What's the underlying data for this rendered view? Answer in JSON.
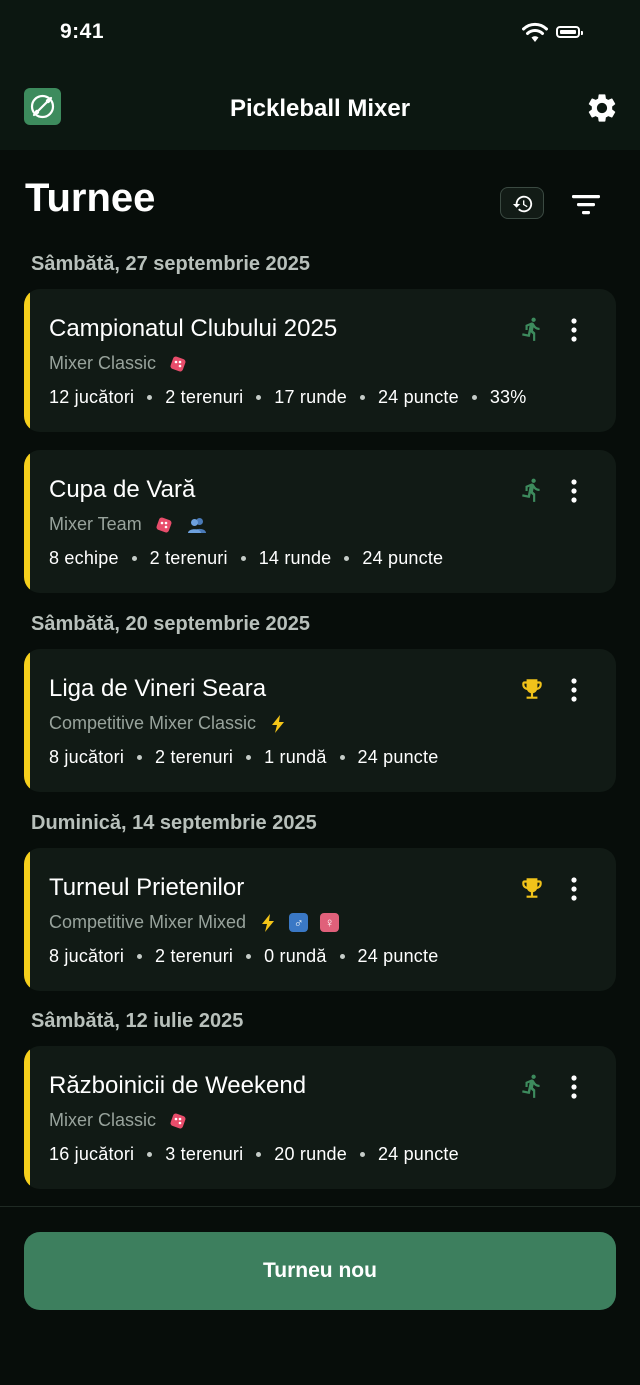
{
  "status_bar": {
    "time": "9:41"
  },
  "app_bar": {
    "title": "Pickleball Mixer"
  },
  "page": {
    "title": "Turnee"
  },
  "date_headers": [
    "Sâmbătă, 27 septembrie 2025",
    "Sâmbătă, 20 septembrie 2025",
    "Duminică, 14 septembrie 2025",
    "Sâmbătă, 12 iulie 2025"
  ],
  "tournaments": [
    {
      "title": "Campionatul Clubului 2025",
      "mode": "Mixer Classic",
      "status_icon": "running-icon",
      "stats": [
        "12 jucători",
        "2 terenuri",
        "17 runde",
        "24 puncte",
        "33%"
      ]
    },
    {
      "title": "Cupa de Vară",
      "mode": "Mixer Team",
      "status_icon": "running-icon",
      "stats": [
        "8 echipe",
        "2 terenuri",
        "14 runde",
        "24 puncte"
      ]
    },
    {
      "title": "Liga de Vineri Seara",
      "mode": "Competitive Mixer Classic",
      "status_icon": "trophy-icon",
      "stats": [
        "8 jucători",
        "2 terenuri",
        "1 rundă",
        "24 puncte"
      ]
    },
    {
      "title": "Turneul Prietenilor",
      "mode": "Competitive Mixer Mixed",
      "status_icon": "trophy-icon",
      "stats": [
        "8 jucători",
        "2 terenuri",
        "0 rundă",
        "24 puncte"
      ]
    },
    {
      "title": "Războinicii de Weekend",
      "mode": "Mixer Classic",
      "status_icon": "running-icon",
      "stats": [
        "16 jucători",
        "3 terenuri",
        "20 runde",
        "24 puncte"
      ]
    }
  ],
  "tags": {
    "male": "♂",
    "female": "♀"
  },
  "actions": {
    "new_tournament": "Turneu nou"
  },
  "colors": {
    "accent": "#f6cf1c",
    "primary": "#3d7f5e",
    "running": "#3d8b5d",
    "trophy": "#f0c21a"
  }
}
